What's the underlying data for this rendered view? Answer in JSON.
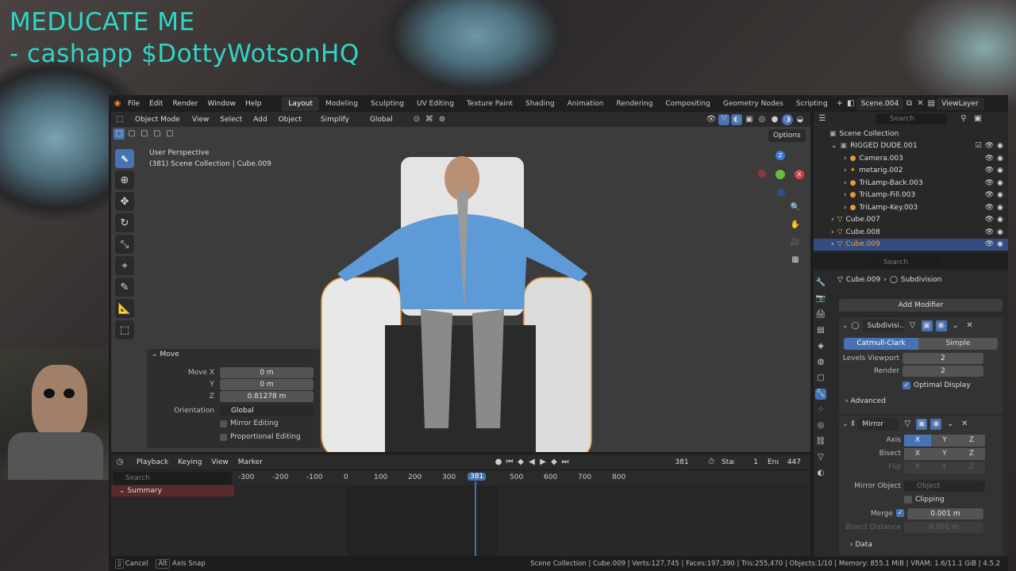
{
  "overlay": {
    "line1": "MEDUCATE ME",
    "line2": "- cashapp $DottyWotsonHQ"
  },
  "menus": [
    "File",
    "Edit",
    "Render",
    "Window",
    "Help"
  ],
  "workspace_tabs": [
    "Layout",
    "Modeling",
    "Sculpting",
    "UV Editing",
    "Texture Paint",
    "Shading",
    "Animation",
    "Rendering",
    "Compositing",
    "Geometry Nodes",
    "Scripting"
  ],
  "active_tab": "Layout",
  "scene": {
    "name": "Scene.004",
    "view_layer": "ViewLayer"
  },
  "viewport_header": {
    "mode": "Object Mode",
    "view": "View",
    "select": "Select",
    "add": "Add",
    "object": "Object",
    "simplify": "Simplify",
    "transform": "Global",
    "options": "Options"
  },
  "viewport": {
    "perspective": "User Perspective",
    "context": "(381) Scene Collection | Cube.009"
  },
  "move_panel": {
    "title": "Move",
    "move_x_label": "Move X",
    "move_x": "0 m",
    "y_label": "Y",
    "y": "0 m",
    "z_label": "Z",
    "z": "0.81278 m",
    "orientation_label": "Orientation",
    "orientation": "Global",
    "mirror_editing": "Mirror Editing",
    "proportional_editing": "Proportional Editing"
  },
  "timeline": {
    "playback": "Playback",
    "keying": "Keying",
    "view": "View",
    "marker": "Marker",
    "current_frame": "381",
    "start_label": "Start",
    "start": "1",
    "end_label": "End",
    "end": "447",
    "search_placeholder": "Search",
    "summary": "Summary",
    "ruler": [
      "-300",
      "-200",
      "-100",
      "0",
      "100",
      "200",
      "300",
      "381",
      "500",
      "600",
      "700",
      "800"
    ]
  },
  "outliner": {
    "search_placeholder": "Search",
    "title": "Scene Collection",
    "items": [
      {
        "label": "RIGGED DUDE.001"
      },
      {
        "label": "Camera.003"
      },
      {
        "label": "metarig.002"
      },
      {
        "label": "TriLamp-Back.003"
      },
      {
        "label": "TriLamp-Fill.003"
      },
      {
        "label": "TriLamp-Key.003"
      },
      {
        "label": "Cube.007"
      },
      {
        "label": "Cube.008"
      },
      {
        "label": "Cube.009"
      }
    ]
  },
  "properties": {
    "search_placeholder": "Search",
    "breadcrumb_object": "Cube.009",
    "breadcrumb_modifier": "Subdivision",
    "add_modifier": "Add Modifier",
    "subdiv": {
      "name": "Subdivisi...",
      "catmull": "Catmull-Clark",
      "simple": "Simple",
      "levels_viewport_label": "Levels Viewport",
      "levels_viewport": "2",
      "render_label": "Render",
      "render": "2",
      "optimal_display": "Optimal Display",
      "advanced": "Advanced"
    },
    "mirror": {
      "name": "Mirror",
      "axis_label": "Axis",
      "bisect_label": "Bisect",
      "flip_label": "Flip",
      "x": "X",
      "y": "Y",
      "z": "Z",
      "mirror_object_label": "Mirror Object",
      "mirror_object_placeholder": "Object",
      "clipping": "Clipping",
      "merge_label": "Merge",
      "merge": "0.001 m",
      "bisect_distance_label": "Bisect Distance",
      "bisect_distance": "0.001 m",
      "data": "Data"
    }
  },
  "status": {
    "cancel": "Cancel",
    "alt": "Alt",
    "axis_snap": "Axis Snap",
    "info": "Scene Collection | Cube.009 | Verts:127,745 | Faces:197,390 | Tris:255,470 | Objects:1/10 | Memory: 855.1 MiB | VRAM: 1.6/11.1 GiB | 4.5.2"
  },
  "colors": {
    "accent": "#4772b3",
    "overlay_text": "#2fd6c8",
    "selection_orange": "#f0a040"
  }
}
